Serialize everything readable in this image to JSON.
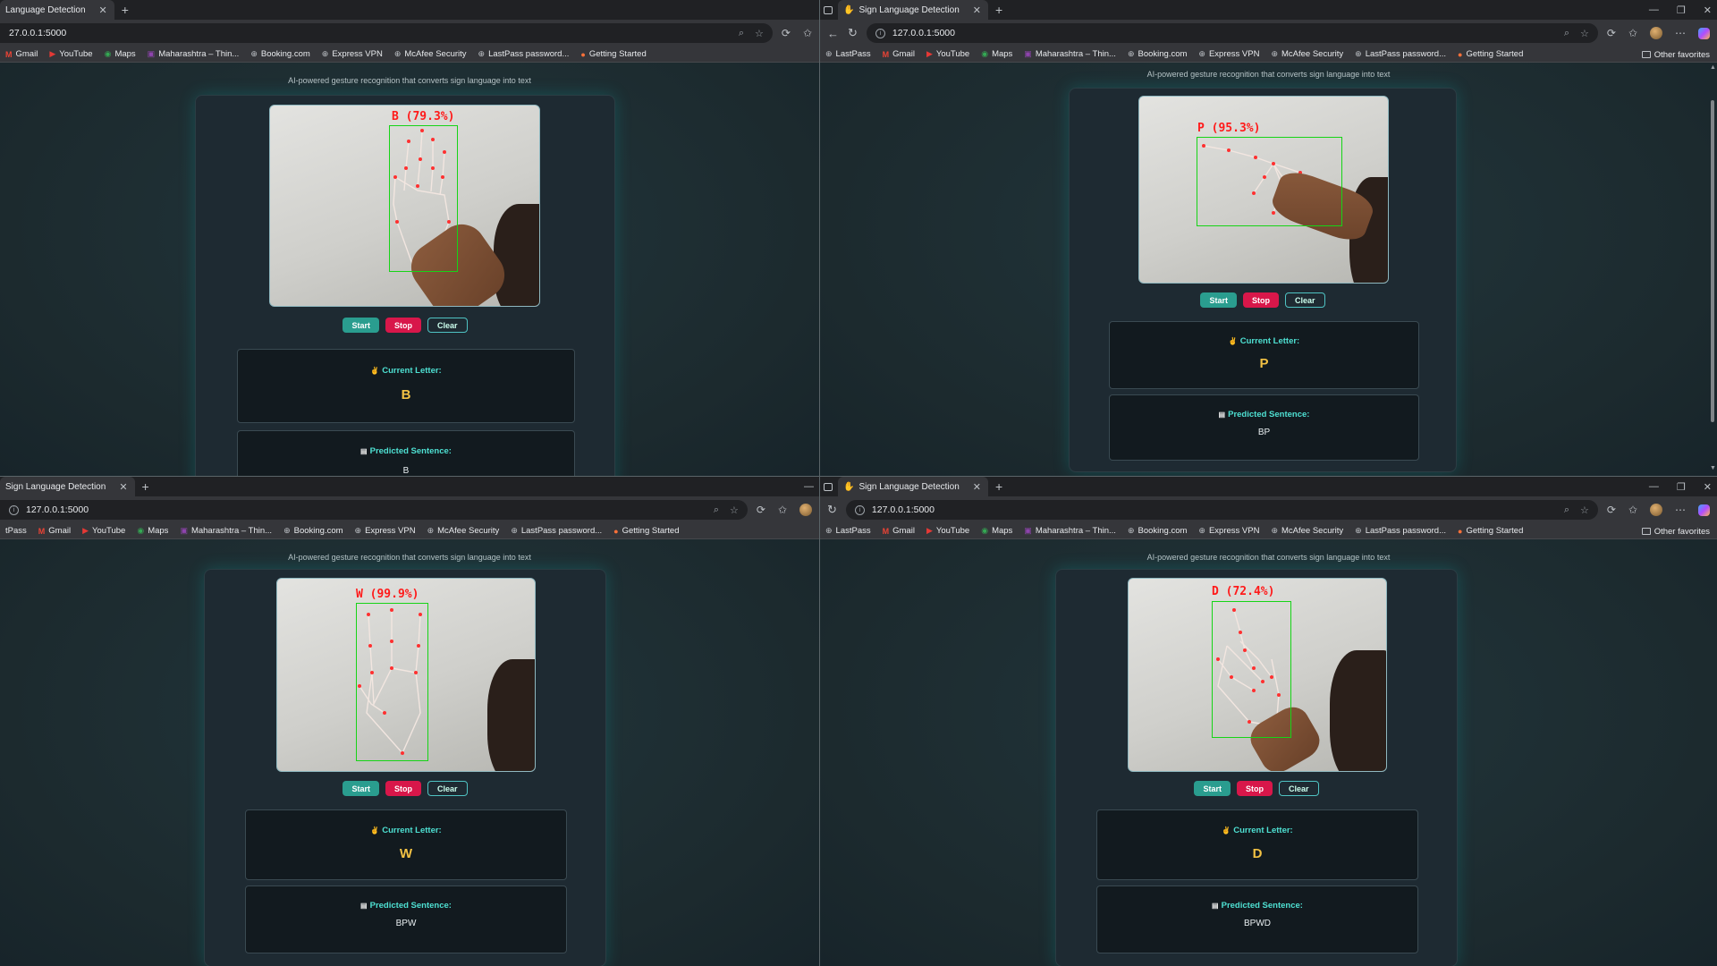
{
  "windows": [
    {
      "tab_title": "Language Detection",
      "url": "27.0.0.1:5000",
      "subtitle": "AI-powered gesture recognition that converts sign language into text",
      "detection_label": "B (79.3%)",
      "buttons": {
        "start": "Start",
        "stop": "Stop",
        "clear": "Clear"
      },
      "current_letter_title": "Current Letter:",
      "current_letter": "B",
      "predicted_sentence_title": "Predicted Sentence:",
      "predicted_sentence": "B",
      "bookmarks": [
        "Gmail",
        "YouTube",
        "Maps",
        "Maharashtra – Thin...",
        "Booking.com",
        "Express VPN",
        "McAfee Security",
        "LastPass password...",
        "Getting Started"
      ]
    },
    {
      "tab_title": "Sign Language Detection",
      "url": "127.0.0.1:5000",
      "subtitle": "AI-powered gesture recognition that converts sign language into text",
      "detection_label": "P (95.3%)",
      "buttons": {
        "start": "Start",
        "stop": "Stop",
        "clear": "Clear"
      },
      "current_letter_title": "Current Letter:",
      "current_letter": "P",
      "predicted_sentence_title": "Predicted Sentence:",
      "predicted_sentence": "BP",
      "bookmarks": [
        "LastPass",
        "Gmail",
        "YouTube",
        "Maps",
        "Maharashtra – Thin...",
        "Booking.com",
        "Express VPN",
        "McAfee Security",
        "LastPass password...",
        "Getting Started"
      ],
      "other_favorites": "Other favorites"
    },
    {
      "tab_title": "Sign Language Detection",
      "url": "127.0.0.1:5000",
      "subtitle": "AI-powered gesture recognition that converts sign language into text",
      "detection_label": "W (99.9%)",
      "buttons": {
        "start": "Start",
        "stop": "Stop",
        "clear": "Clear"
      },
      "current_letter_title": "Current Letter:",
      "current_letter": "W",
      "predicted_sentence_title": "Predicted Sentence:",
      "predicted_sentence": "BPW",
      "bookmarks": [
        "tPass",
        "Gmail",
        "YouTube",
        "Maps",
        "Maharashtra – Thin...",
        "Booking.com",
        "Express VPN",
        "McAfee Security",
        "LastPass password...",
        "Getting Started"
      ]
    },
    {
      "tab_title": "Sign Language Detection",
      "url": "127.0.0.1:5000",
      "subtitle": "AI-powered gesture recognition that converts sign language into text",
      "detection_label": "D (72.4%)",
      "buttons": {
        "start": "Start",
        "stop": "Stop",
        "clear": "Clear"
      },
      "current_letter_title": "Current Letter:",
      "current_letter": "D",
      "predicted_sentence_title": "Predicted Sentence:",
      "predicted_sentence": "BPWD",
      "bookmarks": [
        "LastPass",
        "Gmail",
        "YouTube",
        "Maps",
        "Maharashtra – Thin...",
        "Booking.com",
        "Express VPN",
        "McAfee Security",
        "LastPass password...",
        "Getting Started"
      ],
      "other_favorites": "Other favorites"
    }
  ],
  "icons": {
    "bookmark_icons": [
      "gmail-icon",
      "youtube-icon",
      "maps-icon",
      "maharashtra-icon",
      "globe-icon",
      "globe-icon",
      "globe-icon",
      "globe-icon",
      "firefox-icon"
    ]
  },
  "colors": {
    "start": "#2a9d8f",
    "stop": "#d8174a",
    "letter": "#f3c244",
    "panel_title": "#4ee0d2",
    "bbox": "#16d416",
    "label": "#ff1a1a"
  }
}
